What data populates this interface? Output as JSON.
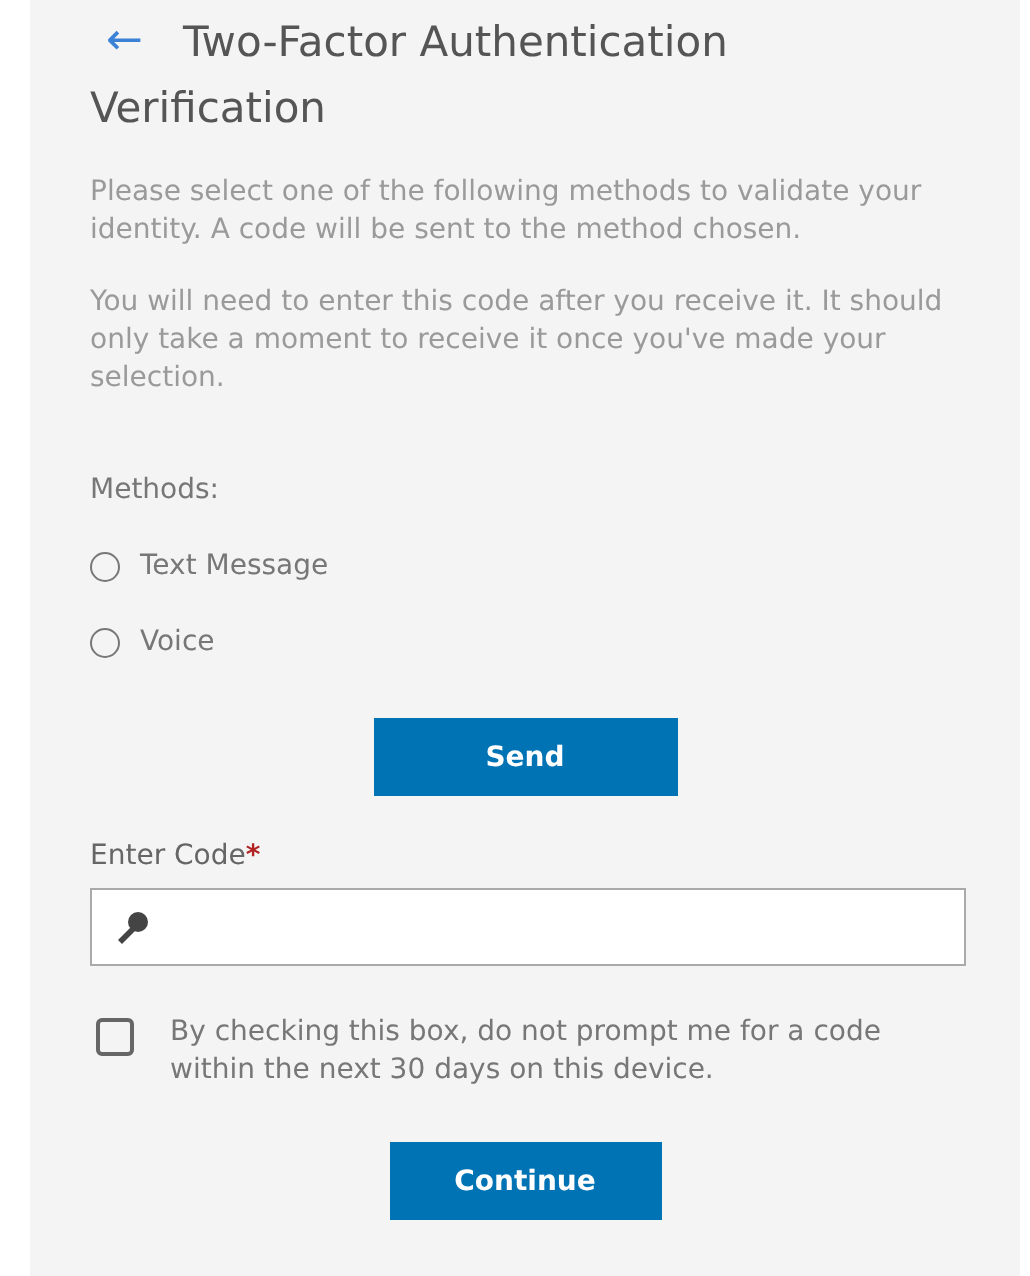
{
  "header": {
    "back": "←",
    "title": "Two-Factor Authentication",
    "subtitle": "Verification"
  },
  "intro": [
    "Please select one of the following methods to validate your identity. A code will be sent to the method chosen.",
    "You will need to enter this code after you receive it. It should only take a moment to receive it once you've made your selection."
  ],
  "methods": {
    "label": "Methods:",
    "options": [
      {
        "label": "Text Message",
        "selected": false
      },
      {
        "label": "Voice",
        "selected": false
      }
    ]
  },
  "send_button": "Send",
  "code_field": {
    "label": "Enter Code",
    "required_mark": "*"
  },
  "remember": {
    "label": "By checking this box, do not prompt me for a code within the next 30 days on this device.",
    "checked": false
  },
  "continue_button": "Continue"
}
